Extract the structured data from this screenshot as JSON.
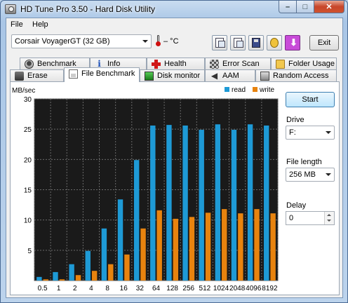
{
  "window": {
    "title": "HD Tune Pro 3.50 - Hard Disk Utility",
    "min_glyph": "–",
    "max_glyph": "□",
    "close_glyph": "✕"
  },
  "menu": {
    "file": "File",
    "help": "Help"
  },
  "toolbar": {
    "drive": "Corsair VoyagerGT (32 GB)",
    "temperature": "– °C",
    "exit_label": "Exit",
    "icons": [
      "copy-text-icon",
      "copy-screenshot-icon",
      "save-icon",
      "options-icon",
      "download-icon"
    ]
  },
  "tabs_row1": [
    {
      "label": "Benchmark",
      "icon": "benchmark-icon"
    },
    {
      "label": "Info",
      "icon": "info-icon"
    },
    {
      "label": "Health",
      "icon": "health-icon"
    },
    {
      "label": "Error Scan",
      "icon": "error-scan-icon"
    },
    {
      "label": "Folder Usage",
      "icon": "folder-icon"
    }
  ],
  "tabs_row2": [
    {
      "label": "Erase",
      "icon": "erase-icon"
    },
    {
      "label": "File Benchmark",
      "icon": "file-benchmark-icon",
      "active": true
    },
    {
      "label": "Disk monitor",
      "icon": "disk-monitor-icon"
    },
    {
      "label": "AAM",
      "icon": "speaker-icon"
    },
    {
      "label": "Random Access",
      "icon": "random-access-icon"
    }
  ],
  "controls": {
    "start": "Start",
    "drive_label": "Drive",
    "drive_value": "F:",
    "file_length_label": "File length",
    "file_length_value": "256 MB",
    "delay_label": "Delay",
    "delay_value": "0"
  },
  "colors": {
    "read": "#1e9ad6",
    "write": "#e8830e",
    "plot_bg": "#1a1a1a",
    "grid": "#6a6a6a"
  },
  "chart_data": {
    "type": "bar",
    "ylabel": "MB/sec",
    "ylim": [
      0,
      30
    ],
    "yticks": [
      "5",
      "10",
      "15",
      "20",
      "25",
      "30"
    ],
    "categories": [
      "0.5",
      "1",
      "2",
      "4",
      "8",
      "16",
      "32",
      "64",
      "128",
      "256",
      "512",
      "1024",
      "2048",
      "4096",
      "8192"
    ],
    "series": [
      {
        "name": "read",
        "values": [
          0.6,
          1.4,
          2.7,
          4.9,
          8.6,
          13.4,
          19.9,
          25.6,
          25.7,
          25.6,
          24.9,
          25.8,
          24.9,
          25.8,
          25.6
        ]
      },
      {
        "name": "write",
        "values": [
          0.2,
          0.2,
          0.9,
          1.6,
          2.7,
          4.3,
          8.6,
          11.6,
          10.2,
          10.5,
          11.2,
          11.8,
          11.1,
          11.8,
          11.1
        ]
      }
    ],
    "grid": true,
    "legend": "top-right"
  }
}
